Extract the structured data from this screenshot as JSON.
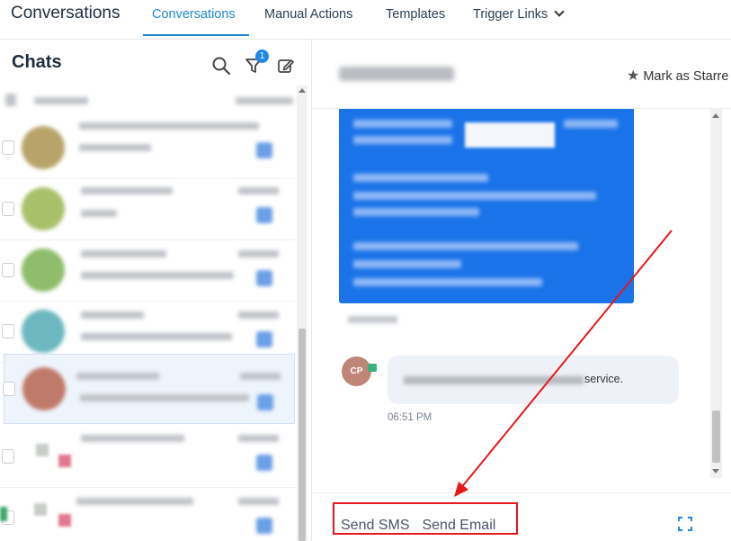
{
  "topnav": {
    "app_title": "Conversations",
    "tabs": [
      {
        "label": "Conversations",
        "active": true
      },
      {
        "label": "Manual Actions",
        "active": false
      },
      {
        "label": "Templates",
        "active": false
      },
      {
        "label": "Trigger Links",
        "active": false
      }
    ]
  },
  "left": {
    "title": "Chats",
    "filter_badge": "1"
  },
  "conversation": {
    "star_label": "Mark as Starre",
    "message_suffix": "service.",
    "message_time": "06:51 PM",
    "avatar_initials": "CP"
  },
  "composer": {
    "sms_label": "Send SMS",
    "email_label": "Send Email"
  },
  "colors": {
    "accent": "#1e88c9",
    "email_bubble": "#1a73e8",
    "annotation": "#e3191c"
  }
}
